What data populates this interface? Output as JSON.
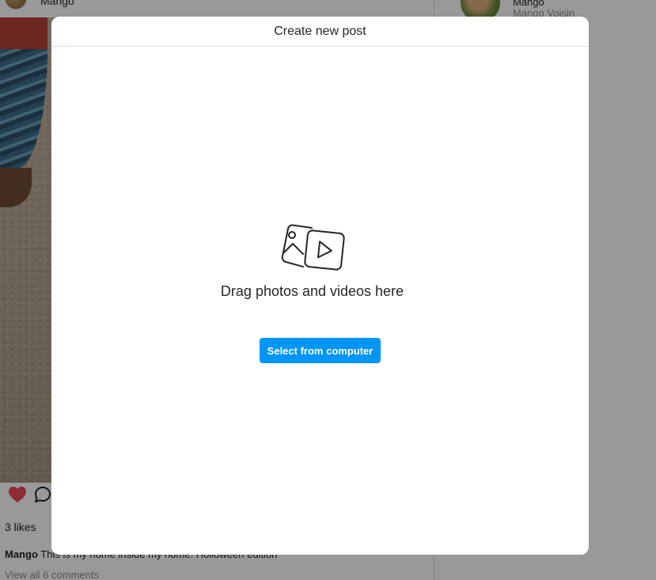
{
  "feed": {
    "post": {
      "username": "Mango",
      "likes": "3 likes",
      "caption_user": "Mango",
      "caption_text": "This is my home inside my home. Holloween edition",
      "view_comments": "View all 6 comments"
    }
  },
  "sidebar": {
    "username": "Mango",
    "full_name": "Mango Voisin"
  },
  "modal": {
    "title": "Create new post",
    "drag_text": "Drag photos and videos here",
    "select_button": "Select from computer",
    "icon": "photo-video-icon"
  },
  "colors": {
    "primary_button": "#0095f6",
    "heart": "#ed4956",
    "overlay": "rgba(0,0,0,0.4)"
  }
}
